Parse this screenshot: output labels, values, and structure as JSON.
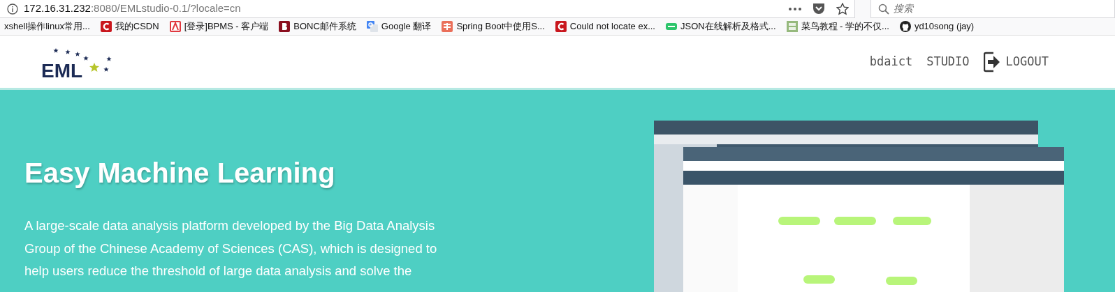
{
  "browser": {
    "address": {
      "host": "172.16.31.232",
      "rest": ":8080/EMLstudio-0.1/?locale=cn"
    },
    "search": {
      "placeholder": "搜索"
    },
    "bookmarks": [
      {
        "label": "xshell操作linux常用...",
        "kind": "plain"
      },
      {
        "label": "我的CSDN",
        "kind": "csdn"
      },
      {
        "label": "[登录]BPMS - 客户端",
        "kind": "bpms"
      },
      {
        "label": "BONC邮件系统",
        "kind": "bonc"
      },
      {
        "label": "Google 翻译",
        "kind": "google"
      },
      {
        "label": "Spring Boot中使用S...",
        "kind": "jian"
      },
      {
        "label": "Could not locate ex...",
        "kind": "csdn"
      },
      {
        "label": "JSON在线解析及格式...",
        "kind": "json"
      },
      {
        "label": "菜鸟教程 - 学的不仅...",
        "kind": "runoob"
      },
      {
        "label": "yd10song (jay)",
        "kind": "github"
      }
    ]
  },
  "header": {
    "logo": "EML",
    "nav": [
      {
        "label": "bdaict",
        "kind": "text"
      },
      {
        "label": "STUDIO",
        "kind": "text"
      },
      {
        "label": "LOGOUT",
        "kind": "logout"
      }
    ]
  },
  "hero": {
    "title": "Easy Machine Learning",
    "lines": [
      "A large-scale data analysis platform developed by the Big Data Analysis",
      "Group of the Chinese Academy of Sciences (CAS), which is designed to",
      "help users reduce the threshold of large data analysis and solve the"
    ]
  }
}
